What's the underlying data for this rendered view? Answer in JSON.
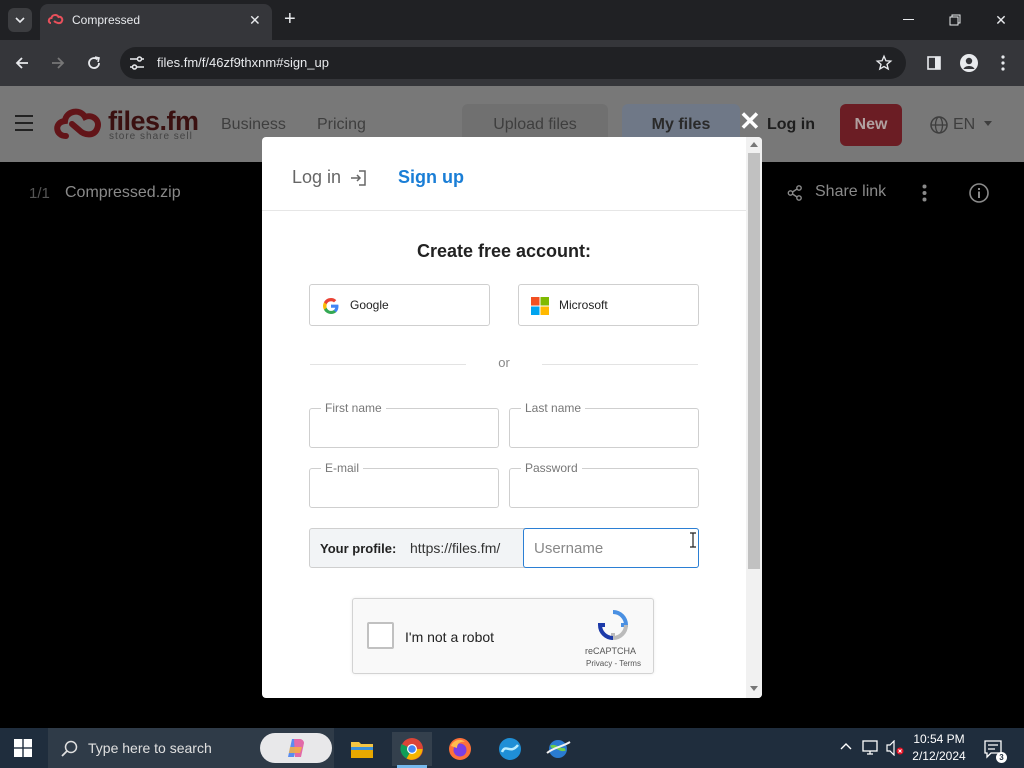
{
  "browser": {
    "tab_title": "Compressed",
    "url": "files.fm/f/46zf9thxnm#sign_up"
  },
  "site": {
    "logo_text": "files.fm",
    "logo_tagline": "store share sell",
    "nav": [
      "Business",
      "Pricing"
    ],
    "upload_label": "Upload files",
    "myfiles_label": "My files",
    "login_label": "Log in",
    "new_label": "New",
    "lang_label": "EN"
  },
  "viewer": {
    "counter": "1/1",
    "file_name": "Compressed.zip",
    "share_label": "Share link"
  },
  "modal": {
    "tab_login": "Log in",
    "tab_signup": "Sign up",
    "heading": "Create free account:",
    "google_label": "Google",
    "microsoft_label": "Microsoft",
    "or_text": "or",
    "first_name_label": "First name",
    "last_name_label": "Last name",
    "email_label": "E-mail",
    "password_label": "Password",
    "profile_label": "Your profile:",
    "profile_prefix": "https://files.fm/",
    "username_placeholder": "Username",
    "captcha_label": "I'm not a robot",
    "captcha_brand": "reCAPTCHA",
    "captcha_links": "Privacy - Terms"
  },
  "taskbar": {
    "search_placeholder": "Type here to search",
    "time": "10:54 PM",
    "date": "2/12/2024",
    "notification_count": "3"
  },
  "colors": {
    "accent_blue": "#1a7ed6",
    "new_button": "#a8212e",
    "logo_red": "#c21e2b"
  }
}
